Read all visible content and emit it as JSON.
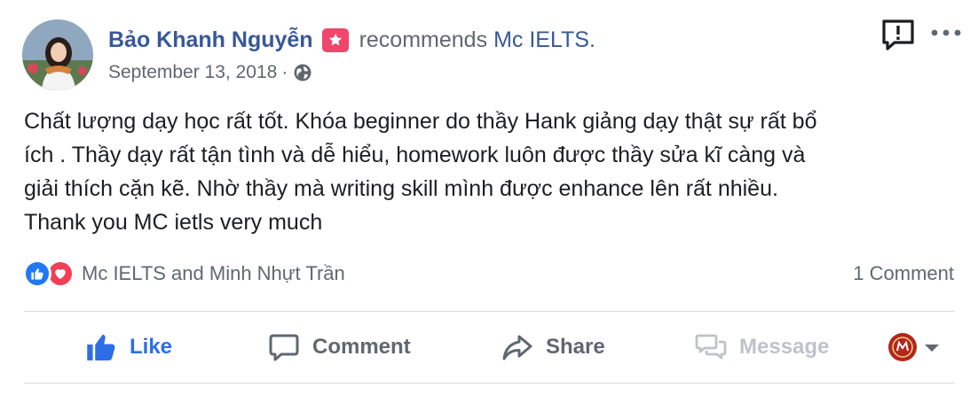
{
  "post": {
    "author": "Bảo Khanh Nguyễn",
    "author_badge_icon": "star-badge-icon",
    "verb": "recommends",
    "page_name": "Mc IELTS.",
    "date": "September 13, 2018",
    "date_separator": "·",
    "privacy_icon": "globe-icon",
    "text_lines": [
      "Chất lượng dạy học rất tốt. Khóa beginner do thầy Hank giảng dạy thật sự rất bổ",
      "ích . Thầy dạy rất tận tình và dễ hiểu, homework luôn được thầy sửa kĩ càng và",
      "giải thích cặn kẽ. Nhờ thầy mà writing skill mình được enhance lên rất nhiều.",
      "Thank you MC ietls very much"
    ]
  },
  "reactions": {
    "icons": [
      "like-reaction-icon",
      "love-reaction-icon"
    ],
    "names": "Mc IELTS and Minh Nhựt Trần",
    "comment_count": "1 Comment"
  },
  "actions": {
    "like": "Like",
    "comment": "Comment",
    "share": "Share",
    "message": "Message"
  },
  "colors": {
    "link": "#385898",
    "like_active": "#2d6ee6",
    "secondary_text": "#606770",
    "disabled_text": "#bec3c9",
    "badge": "#f0466c",
    "like_reaction": "#2078f4",
    "love_reaction": "#f33e58"
  }
}
